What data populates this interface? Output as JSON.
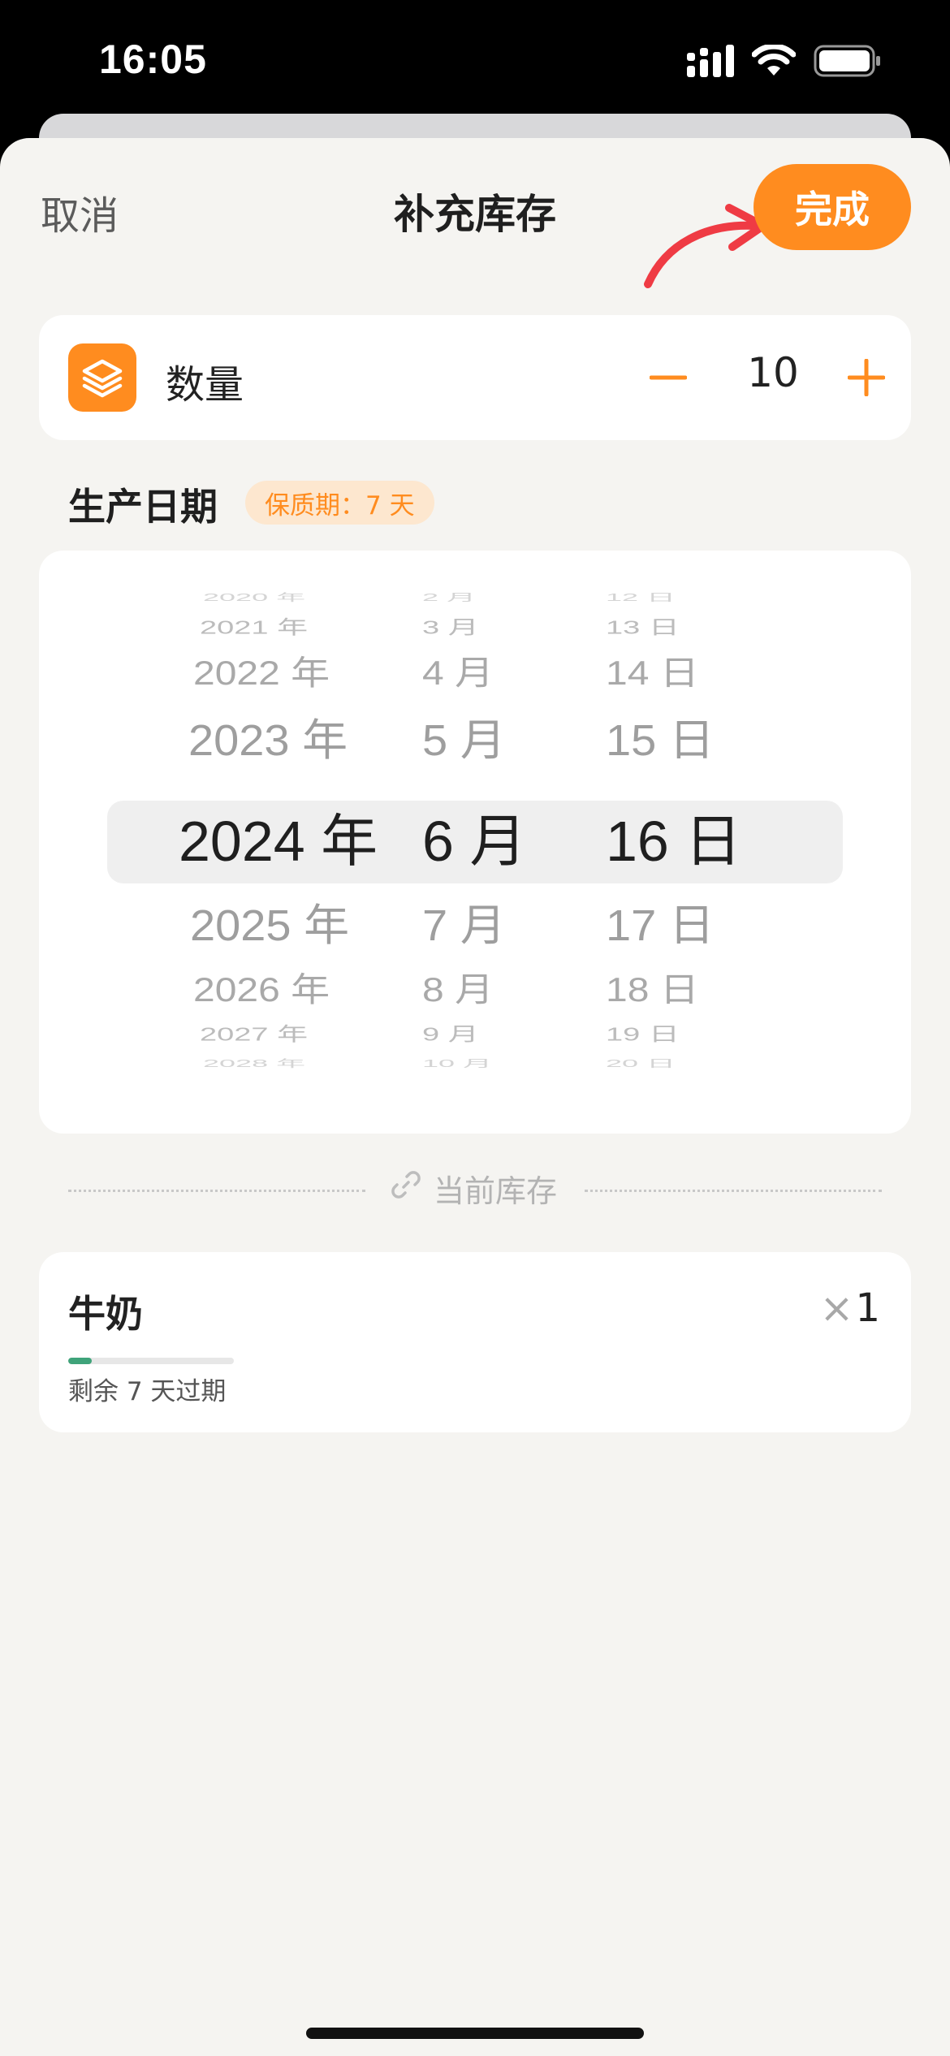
{
  "status_bar": {
    "time": "16:05"
  },
  "header": {
    "cancel_label": "取消",
    "title": "补充库存",
    "done_label": "完成"
  },
  "quantity": {
    "label": "数量",
    "value": "10",
    "icon": "layers-icon",
    "minus_icon": "minus-icon",
    "plus_icon": "plus-icon"
  },
  "production_date": {
    "label": "生产日期",
    "shelf_life_badge": "保质期：7 天",
    "picker": {
      "years": [
        "2020 年",
        "2021 年",
        "2022 年",
        "2023 年",
        "2024 年",
        "2025 年",
        "2026 年",
        "2027 年",
        "2028 年"
      ],
      "months": [
        "2 月",
        "3 月",
        "4 月",
        "5 月",
        "6 月",
        "7 月",
        "8 月",
        "9 月",
        "10 月"
      ],
      "days": [
        "12 日",
        "13 日",
        "14 日",
        "15 日",
        "16 日",
        "17 日",
        "18 日",
        "19 日",
        "20 日"
      ],
      "selected": {
        "year": "2024 年",
        "month": "6 月",
        "day": "16 日"
      }
    }
  },
  "current_stock": {
    "divider_label": "当前库存",
    "item": {
      "name": "牛奶",
      "quantity_prefix": "×",
      "quantity": "1",
      "remaining_text": "剩余 7 天过期",
      "progress_fraction": 0.14
    }
  },
  "colors": {
    "accent": "#ff8c1f",
    "badge_bg": "#fde7cf",
    "sheet_bg": "#f5f4f1",
    "progress_fill": "#3fa37a",
    "annotation_arrow": "#ef3b44"
  }
}
